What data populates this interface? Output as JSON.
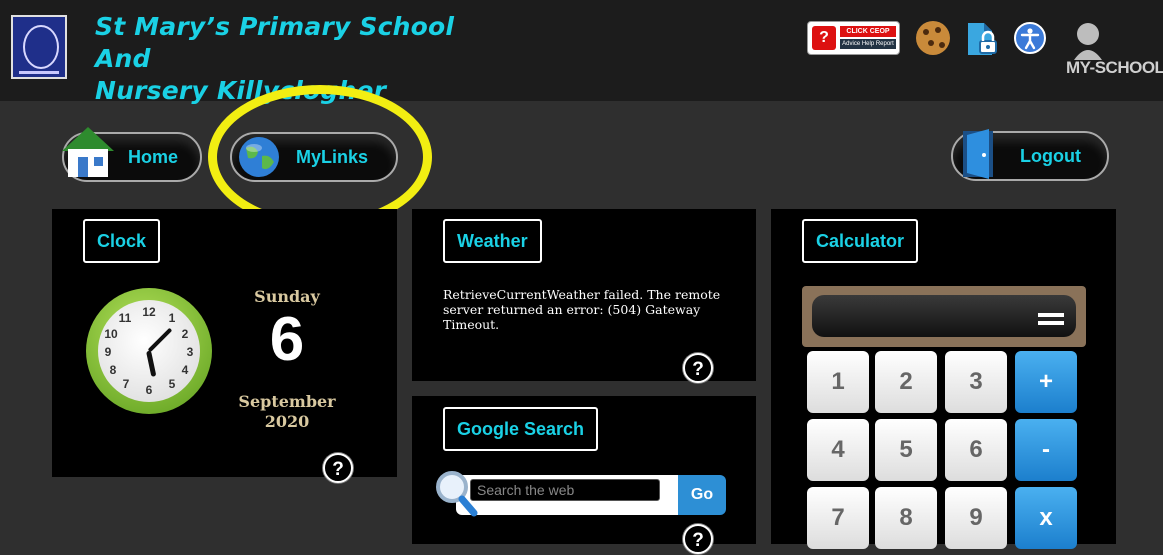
{
  "header": {
    "title_line1": "St Mary’s Primary School And",
    "title_line2": "Nursery Killyclogher",
    "ceop": {
      "logo": "?",
      "top": "CLICK CEOP",
      "bottom": "Advice Help Report"
    },
    "myschool_text": "MY-SCHOOL"
  },
  "nav": {
    "home_label": "Home",
    "mylinks_label": "MyLinks",
    "logout_label": "Logout"
  },
  "clock": {
    "label": "Clock",
    "day_name": "Sunday",
    "day_number": "6",
    "month": "September",
    "year": "2020",
    "face_numbers": [
      "12",
      "1",
      "2",
      "3",
      "4",
      "5",
      "6",
      "7",
      "8",
      "9",
      "10",
      "11"
    ],
    "help": "?"
  },
  "weather": {
    "label": "Weather",
    "message": "RetrieveCurrentWeather failed. The remote server returned an error: (504) Gateway Timeout.",
    "help": "?"
  },
  "google": {
    "label": "Google Search",
    "placeholder": "Search the web",
    "go_label": "Go",
    "help": "?"
  },
  "calculator": {
    "label": "Calculator",
    "keys": [
      "1",
      "2",
      "3",
      "+",
      "4",
      "5",
      "6",
      "-",
      "7",
      "8",
      "9",
      "x"
    ]
  },
  "colors": {
    "accent": "#1ad1e5",
    "highlight": "#f2ee12",
    "operator_key": "#2d8fd5"
  }
}
